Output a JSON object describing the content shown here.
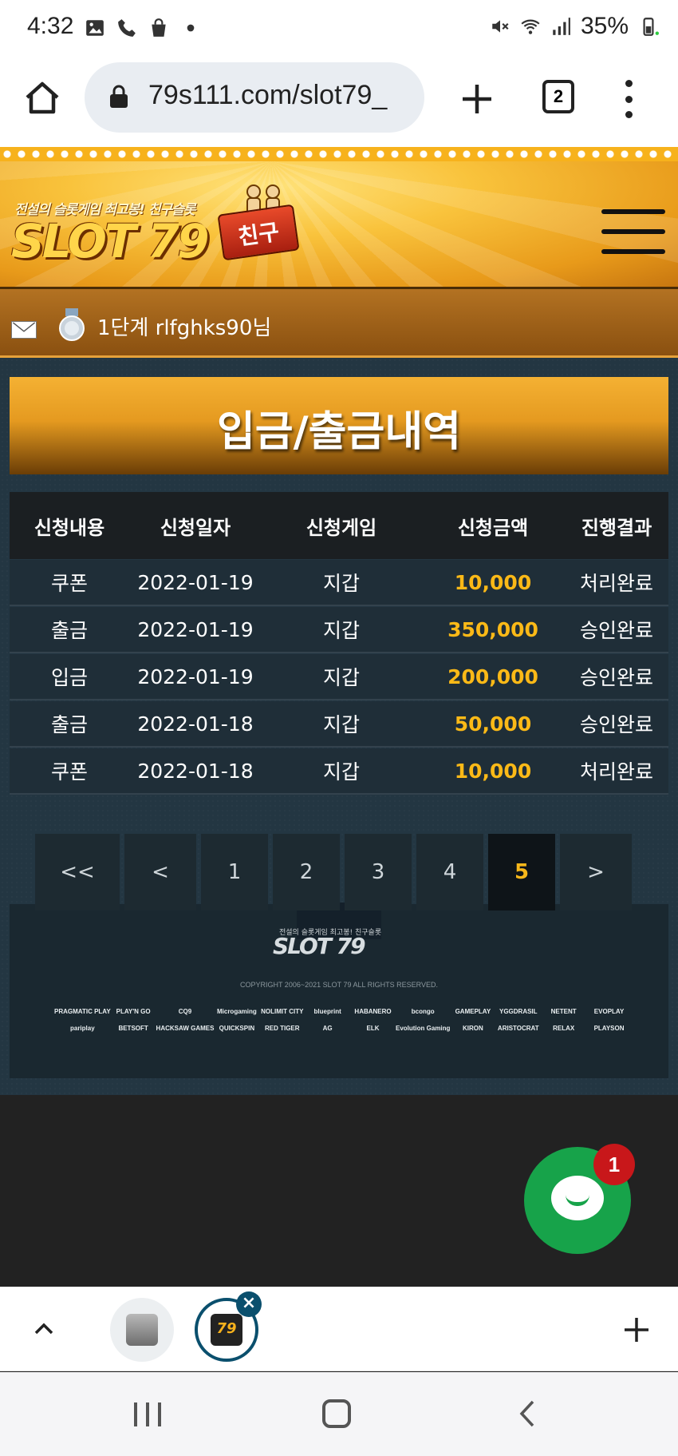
{
  "status_bar": {
    "time": "4:32",
    "battery": "35%",
    "icons": [
      "image-icon",
      "phone-icon",
      "shopping-bag-icon",
      "dot-icon",
      "mute-icon",
      "wifi-icon",
      "signal-icon",
      "battery-icon"
    ]
  },
  "browser": {
    "url": "79s111.com/slot79_",
    "tab_count": "2"
  },
  "site": {
    "tagline": "전설의 슬롯게임 최고봉! 친구슬롯",
    "brand": "SLOT 79",
    "badge": "친구",
    "accent_color": "#f7b21c"
  },
  "user": {
    "level_text": "1단계 rlfghks90님"
  },
  "page": {
    "title": "입금/출금내역"
  },
  "table": {
    "headers": [
      "신청내용",
      "신청일자",
      "신청게임",
      "신청금액",
      "진행결과"
    ],
    "rows": [
      {
        "type": "쿠폰",
        "date": "2022-01-19",
        "game": "지갑",
        "amount": "10,000",
        "status": "처리완료"
      },
      {
        "type": "출금",
        "date": "2022-01-19",
        "game": "지갑",
        "amount": "350,000",
        "status": "승인완료"
      },
      {
        "type": "입금",
        "date": "2022-01-19",
        "game": "지갑",
        "amount": "200,000",
        "status": "승인완료"
      },
      {
        "type": "출금",
        "date": "2022-01-18",
        "game": "지갑",
        "amount": "50,000",
        "status": "승인완료"
      },
      {
        "type": "쿠폰",
        "date": "2022-01-18",
        "game": "지갑",
        "amount": "10,000",
        "status": "처리완료"
      }
    ]
  },
  "pagination": {
    "first": "<<",
    "prev": "<",
    "pages": [
      "1",
      "2",
      "3",
      "4",
      "5"
    ],
    "active_page": "5",
    "next": ">"
  },
  "footer": {
    "logo_tagline": "전설의 슬롯게임 최고봉! 친구슬롯",
    "logo": "SLOT 79",
    "copyright": "COPYRIGHT 2006~2021 SLOT 79 ALL RIGHTS RESERVED.",
    "providers": [
      "PRAGMATIC PLAY",
      "PLAY'N GO",
      "CQ9",
      "Microgaming",
      "NOLIMIT CITY",
      "blueprint",
      "HABANERO",
      "bcongo",
      "GAMEPLAY",
      "YGGDRASIL",
      "NETENT",
      "EVOPLAY",
      "pariplay",
      "BETSOFT",
      "HACKSAW GAMES",
      "QUICKSPIN",
      "RED TIGER",
      "AG",
      "ELK",
      "Evolution Gaming",
      "KIRON",
      "ARISTOCRAT",
      "RELAX",
      "PLAYSON"
    ]
  },
  "chat": {
    "badge_count": "1"
  }
}
